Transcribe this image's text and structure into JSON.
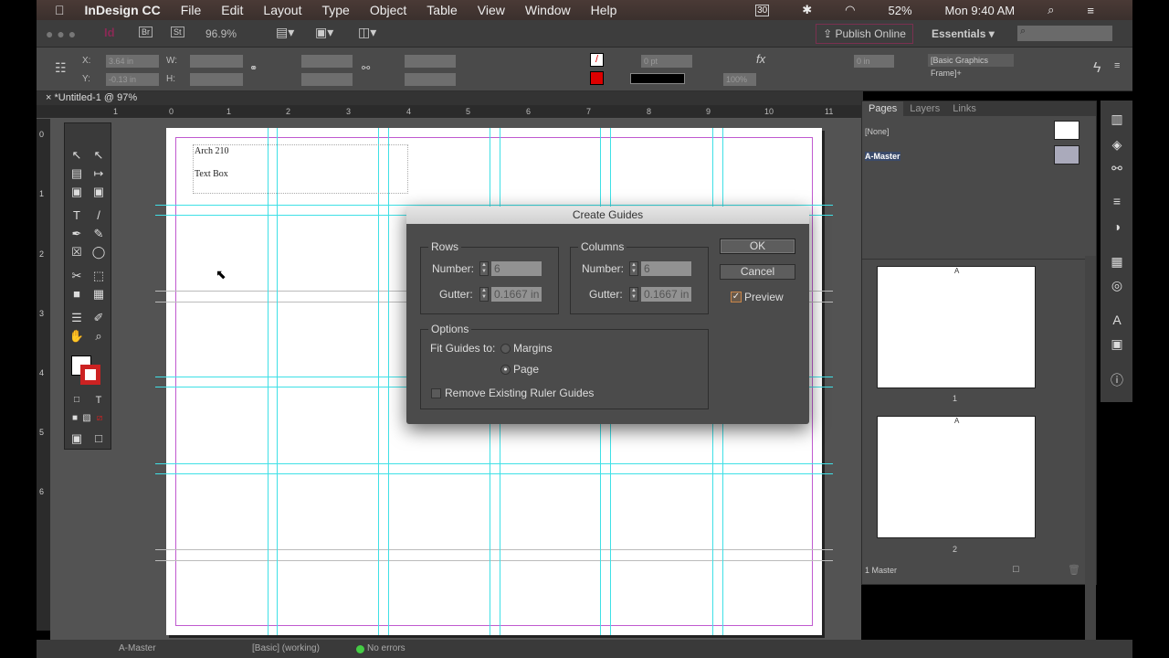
{
  "menubar": {
    "app": "InDesign CC",
    "items": [
      "File",
      "Edit",
      "Layout",
      "Type",
      "Object",
      "Table",
      "View",
      "Window",
      "Help"
    ],
    "battery": "52%",
    "clock": "Mon 9:40 AM",
    "calendar_badge": "30"
  },
  "appbar": {
    "bridge": "Br",
    "stock": "St",
    "zoom": "96.9%",
    "publish": "Publish Online",
    "workspace": "Essentials"
  },
  "control": {
    "x_label": "X:",
    "x": "3.64 in",
    "y_label": "Y:",
    "y": "-0.13 in",
    "w_label": "W:",
    "h_label": "H:",
    "stroke": "0 pt",
    "opacity": "100%",
    "offset": "0 in",
    "object_style": "[Basic Graphics Frame]+"
  },
  "document": {
    "tab": "*Untitled-1 @ 97%",
    "text1": "Arch 210",
    "text2": "Text Box"
  },
  "ruler": {
    "ticks": [
      "1",
      "0",
      "1",
      "2",
      "3",
      "4",
      "5",
      "6",
      "7",
      "8",
      "9",
      "10",
      "11"
    ],
    "vticks": [
      "0",
      "1",
      "2",
      "3",
      "4",
      "5",
      "6"
    ]
  },
  "dialog": {
    "title": "Create Guides",
    "rows": {
      "label": "Rows",
      "number_label": "Number:",
      "number": "6",
      "gutter_label": "Gutter:",
      "gutter": "0.1667 in"
    },
    "columns": {
      "label": "Columns",
      "number_label": "Number:",
      "number": "6",
      "gutter_label": "Gutter:",
      "gutter": "0.1667 in"
    },
    "options": {
      "label": "Options",
      "fit_label": "Fit Guides to:",
      "margins": "Margins",
      "page": "Page",
      "remove": "Remove Existing Ruler Guides"
    },
    "ok": "OK",
    "cancel": "Cancel",
    "preview": "Preview"
  },
  "pages": {
    "tabs": [
      "Pages",
      "Layers",
      "Links"
    ],
    "none": "[None]",
    "master": "A-Master",
    "page_letter": "A",
    "page1": "1",
    "page2": "2",
    "footer": "1 Master"
  },
  "status": {
    "page": "A-Master",
    "preflight_profile": "[Basic] (working)",
    "errors": "No errors"
  }
}
